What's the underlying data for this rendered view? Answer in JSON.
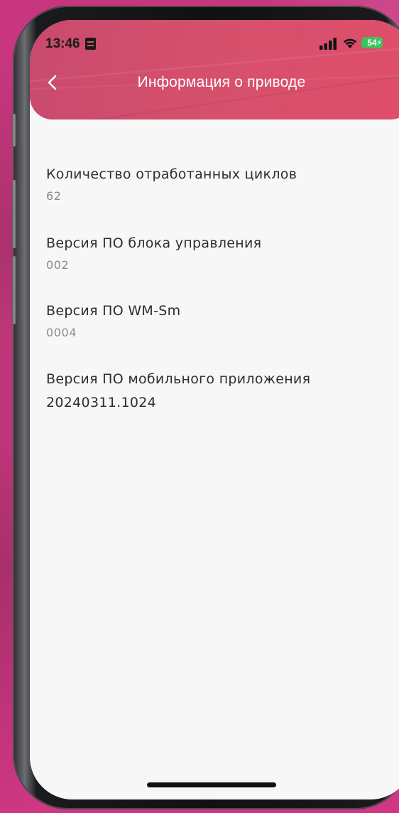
{
  "status_bar": {
    "time": "13:46",
    "battery_level": "54",
    "icons": [
      "sim-card-icon",
      "cellular-signal-icon",
      "wifi-icon",
      "battery-charging-icon"
    ]
  },
  "header": {
    "title": "Информация о приводе",
    "back_icon": "chevron-left-icon"
  },
  "info": {
    "cycles": {
      "label": "Количество отработанных циклов",
      "value": "62"
    },
    "control_unit_fw": {
      "label": "Версия ПО блока управления",
      "value": "002"
    },
    "wm_sm_fw": {
      "label": "Версия ПО WM-Sm",
      "value": "0004"
    },
    "mobile_app": {
      "label": "Версия ПО мобильного приложения",
      "value": "20240311.1024"
    }
  },
  "colors": {
    "header_gradient_start": "#c94a6e",
    "header_gradient_end": "#df4e6a",
    "battery": "#3dc15d",
    "background": "#d23b86"
  }
}
